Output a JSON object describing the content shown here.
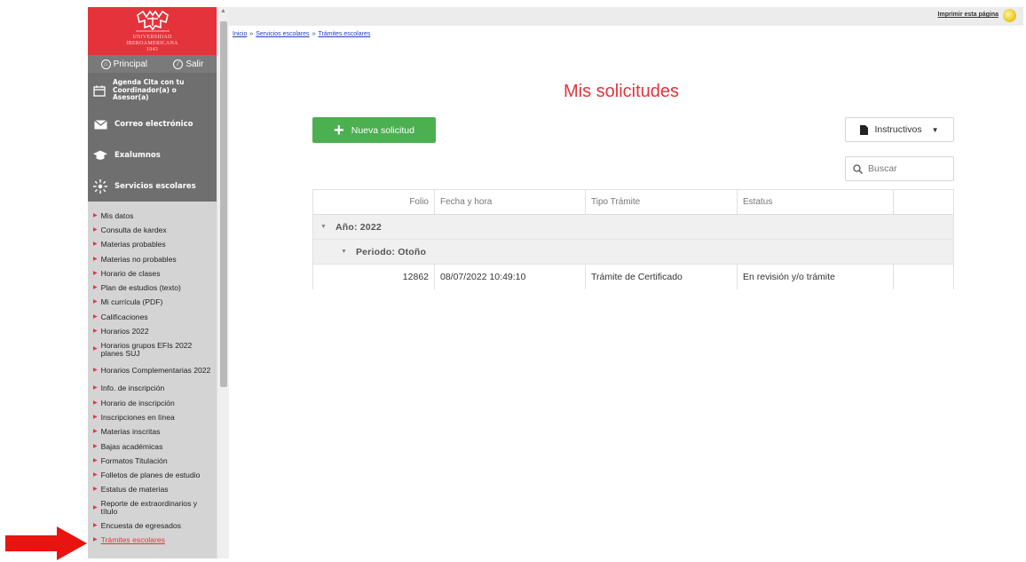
{
  "sidebar": {
    "logo_text": "UNIVERSIDAD\nIBEROAMERICANA\n1943",
    "topnav": {
      "principal": "Principal",
      "salir": "Salir"
    },
    "main_menu": [
      {
        "icon": "calendar-icon",
        "label": "Agenda Cita con tu Coordinador(a) o Asesor(a)"
      },
      {
        "icon": "mail-icon",
        "label": "Correo electrónico"
      },
      {
        "icon": "graduation-cap-icon",
        "label": "Exalumnos"
      },
      {
        "icon": "sparkle-icon",
        "label": "Servicios escolares"
      }
    ],
    "sub_items": [
      "Mis datos",
      "Consulta de kardex",
      "Materias probables",
      "Materias no probables",
      "Horario de clases",
      "Plan de estudios (texto)",
      "Mi currícula (PDF)",
      "Calificaciones",
      "Horarios 2022",
      "Horarios grupos EFIs 2022 planes SUJ",
      "Horarios Complementarias 2022",
      "Info. de inscripción",
      "Horario de inscripción",
      "Inscripciones en línea",
      "Materias inscritas",
      "Bajas académicas",
      "Formatos Titulación",
      "Folletos de planes de estudio",
      "Estatus de materias",
      "Reporte de extraordinarios y título",
      "Encuesta de egresados",
      "Trámites escolares"
    ]
  },
  "topbar": {
    "print_label": "Imprimir esta página"
  },
  "breadcrumb": {
    "items": [
      "Inicio",
      "Servicios escolares",
      "Trámites escolares"
    ],
    "separator": "»"
  },
  "main": {
    "title": "Mis solicitudes",
    "new_button": "Nueva solicitud",
    "instructivos_button": "Instructivos",
    "search_placeholder": "Buscar",
    "columns": [
      "Folio",
      "Fecha y hora",
      "Tipo Trámite",
      "Estatus",
      ""
    ],
    "group_year": "Año: 2022",
    "group_period": "Periodo: Otoño",
    "rows": [
      {
        "folio": "12862",
        "fecha": "08/07/2022 10:49:10",
        "tipo": "Trámite de Certificado",
        "estatus": "En revisión y/o trámite"
      }
    ]
  },
  "colors": {
    "brand_red": "#e5333b",
    "sidebar_gray": "#6f6f6f",
    "success_green": "#4caf50",
    "link_blue": "#1f3fbf"
  }
}
